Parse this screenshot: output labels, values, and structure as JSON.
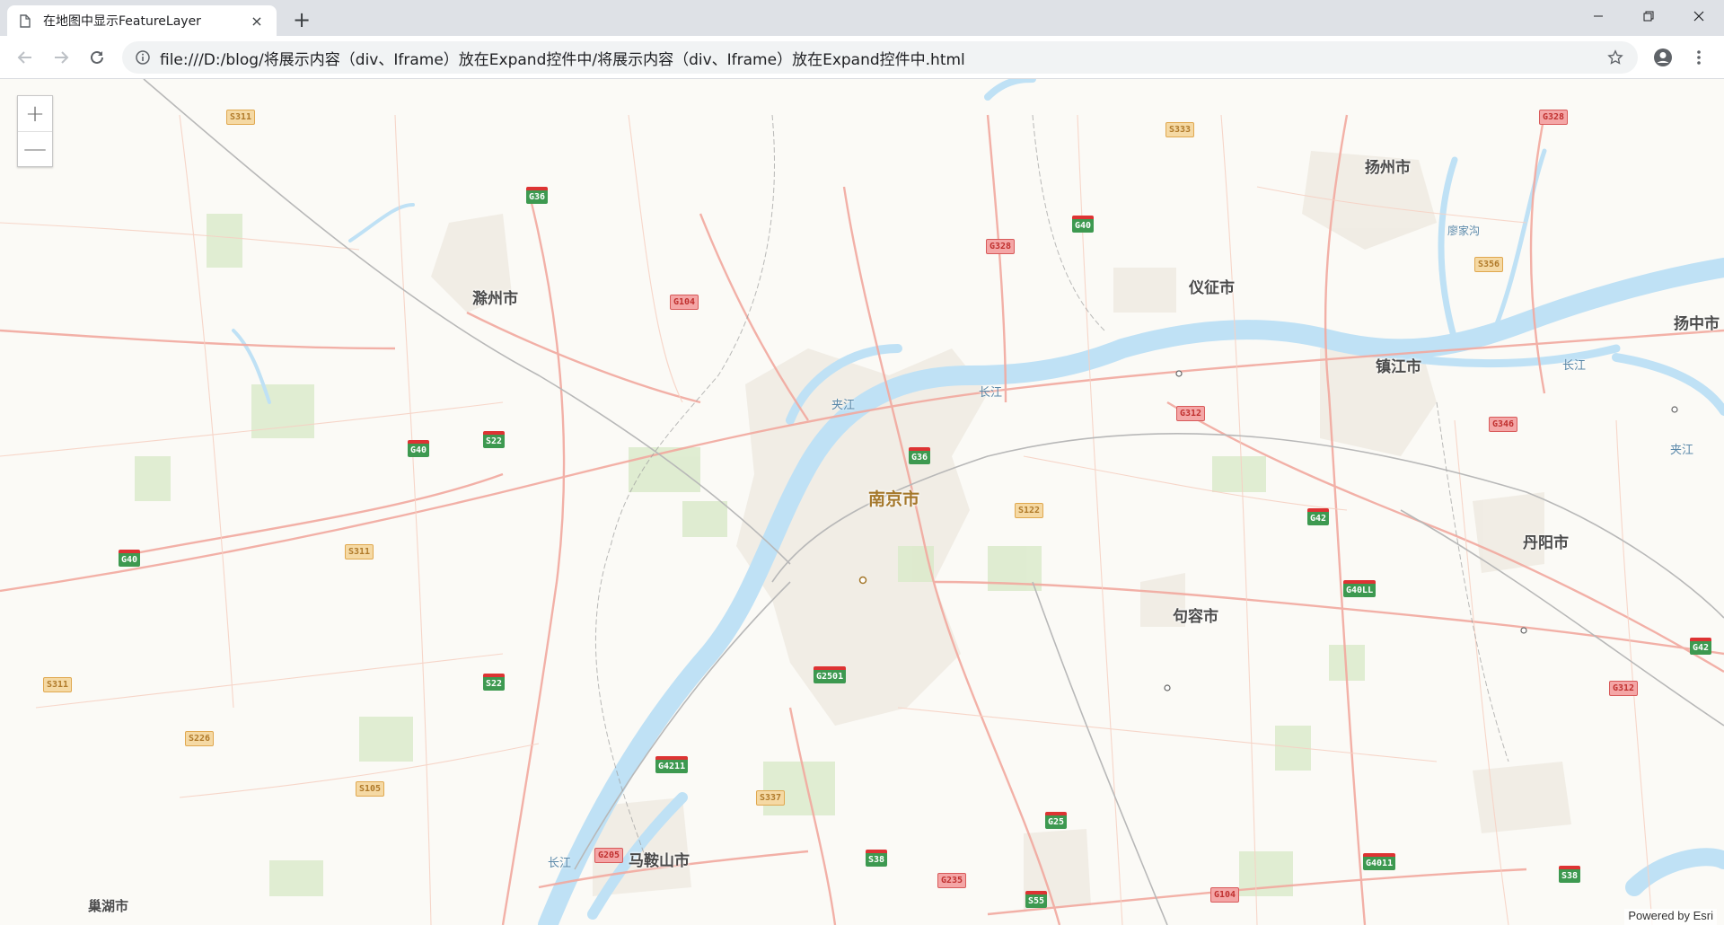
{
  "browser": {
    "tab_title": "在地图中显示FeatureLayer",
    "url": "file:///D:/blog/将展示内容（div、Iframe）放在Expand控件中/将展示内容（div、Iframe）放在Expand控件中.html",
    "new_tab_label": "+",
    "close_tab_label": "×"
  },
  "map": {
    "attribution": "Powered by Esri",
    "zoom_in_label": "+",
    "zoom_out_label": "—",
    "cities": {
      "nanjing": "南京市",
      "chuzhou": "滁州市",
      "yizheng": "仪征市",
      "yangzhou": "扬州市",
      "zhenjiang": "镇江市",
      "yangzhong": "扬中市",
      "danyang": "丹阳市",
      "jurong": "句容市",
      "maanshan": "马鞍山市",
      "chaohu": "巢湖市"
    },
    "water_labels": {
      "jiajiang": "夹江",
      "changjiang1": "长江",
      "changjiang2": "长江",
      "changjiang3": "长江",
      "jiajiang2": "夹江",
      "liaojiagou": "廖家沟"
    },
    "shields": {
      "s311a": "S311",
      "g36a": "G36",
      "g40a": "G40",
      "g328a": "G328",
      "s333": "S333",
      "g328b": "G328",
      "s356": "S356",
      "g104a": "G104",
      "g40b": "G40",
      "s22a": "S22",
      "g36b": "G36",
      "g312": "G312",
      "g346": "G346",
      "s122": "S122",
      "g42a": "G42",
      "g40c": "G40",
      "s311b": "S311",
      "g40ll": "G40LL",
      "s311c": "S311",
      "s22b": "S22",
      "g2501": "G2501",
      "g42b": "G42",
      "g312b": "G312",
      "s226": "S226",
      "g4211": "G4211",
      "s105": "S105",
      "s337": "S337",
      "g25": "G25",
      "g205": "G205",
      "s38": "S38",
      "g235": "G235",
      "s55": "S55",
      "g104b": "G104",
      "g4011": "G4011",
      "s38b": "S38"
    }
  }
}
